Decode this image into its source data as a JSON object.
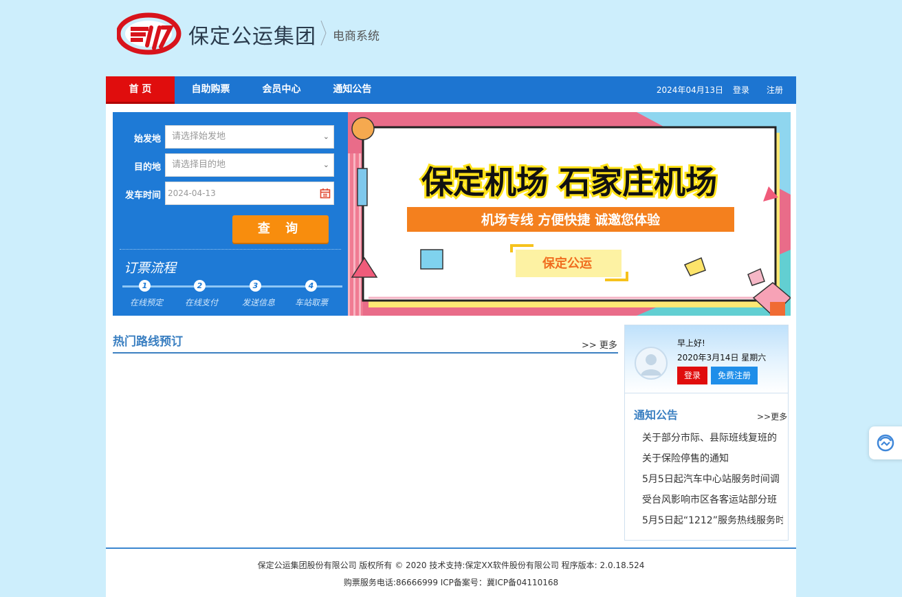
{
  "header": {
    "brand_name": "保定公运集团",
    "subsystem": "电商系统"
  },
  "nav": {
    "items": [
      {
        "label": "首 页",
        "active": true
      },
      {
        "label": "自助购票",
        "active": false
      },
      {
        "label": "会员中心",
        "active": false
      },
      {
        "label": "通知公告",
        "active": false
      }
    ],
    "date": "2024年04月13日",
    "login": "登录",
    "register": "注册"
  },
  "search": {
    "origin_label": "始发地",
    "origin_placeholder": "请选择始发地",
    "destination_label": "目的地",
    "destination_placeholder": "请选择目的地",
    "date_label": "发车时间",
    "date_value": "2024-04-13",
    "query_button": "查 询",
    "flow_title": "订票流程",
    "flow_steps": [
      {
        "num": "1",
        "label": "在线预定"
      },
      {
        "num": "2",
        "label": "在线支付"
      },
      {
        "num": "3",
        "label": "发送信息"
      },
      {
        "num": "4",
        "label": "车站取票"
      }
    ]
  },
  "banner": {
    "headline": "保定机场 石家庄机场",
    "slogan": "机场专线  方便快捷  诚邀您体验",
    "tag": "保定公运"
  },
  "hot_routes": {
    "title": "热门路线预订",
    "more": ">> 更多"
  },
  "user_panel": {
    "greeting": "早上好!",
    "date": "2020年3月14日 星期六",
    "login_button": "登录",
    "register_button": "免费注册"
  },
  "notices": {
    "title": "通知公告",
    "more": ">>更多",
    "items": [
      "关于部分市际、县际班线复班的",
      "关于保险停售的通知",
      "5月5日起汽车中心站服务时间调",
      "受台风影响市区各客运站部分班",
      "5月5日起“1212”服务热线服务时"
    ]
  },
  "footer": {
    "line1": "保定公运集团股份有限公司 版权所有 © 2020 技术支持:保定XX软件股份有限公司 程序版本: 2.0.18.524",
    "line2": "购票服务电话:86666999 ICP备案号：冀ICP备04110168"
  },
  "colors": {
    "page_bg": "#cdeefc",
    "nav_blue": "#1d75d1",
    "nav_active_red": "#e00d0d",
    "search_panel_blue": "#1e7ad6",
    "query_orange": "#f88d0d",
    "section_title_blue": "#3a7fc1"
  }
}
